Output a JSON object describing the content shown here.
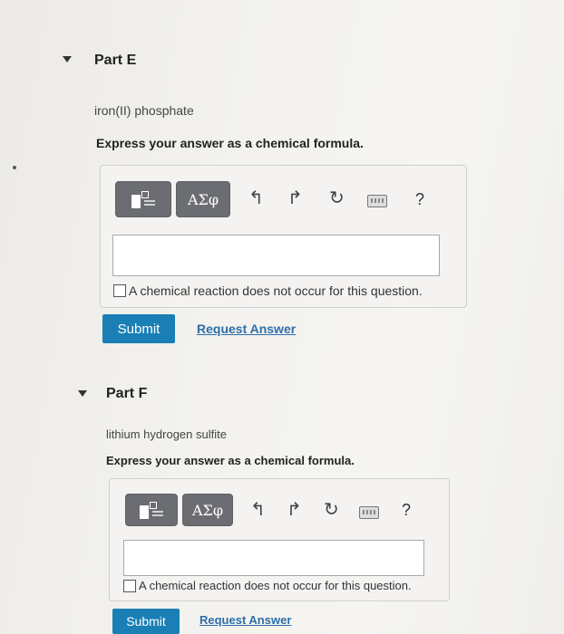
{
  "parts": [
    {
      "title": "Part E",
      "prompt": "iron(II) phosphate",
      "instruction": "Express your answer as a chemical formula.",
      "greek_label": "ΑΣφ",
      "help_label": "?",
      "answer_value": "",
      "checkbox_label": "A chemical reaction does not occur for this question.",
      "submit_label": "Submit",
      "request_label": "Request Answer"
    },
    {
      "title": "Part F",
      "prompt": "lithium hydrogen sulfite",
      "instruction": "Express your answer as a chemical formula.",
      "greek_label": "ΑΣφ",
      "help_label": "?",
      "answer_value": "",
      "checkbox_label": "A chemical reaction does not occur for this question.",
      "submit_label": "Submit",
      "request_label": "Request Answer"
    }
  ],
  "colors": {
    "submit_bg": "#1a7fb5",
    "link": "#2e6ea8",
    "toolbar_btn": "#6b6d72"
  },
  "icons": [
    "caret-down-icon",
    "template-icon",
    "undo-icon",
    "redo-icon",
    "reset-icon",
    "keyboard-icon",
    "help-icon"
  ]
}
